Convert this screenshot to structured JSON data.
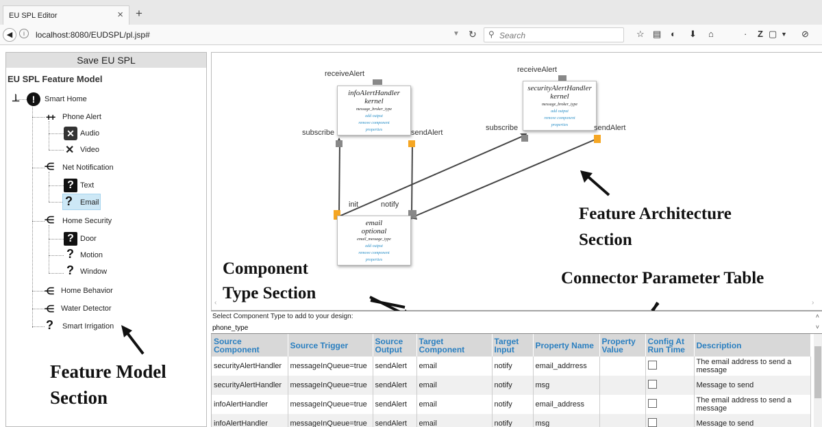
{
  "browser": {
    "tab_title": "EU SPL Editor",
    "url": "localhost:8080/EUDSPL/pl.jsp#",
    "search_placeholder": "Search"
  },
  "left_panel": {
    "save_label": "Save EU SPL",
    "title": "EU SPL Feature Model",
    "tree": {
      "root": "Smart Home",
      "phone_alert": "Phone Alert",
      "audio": "Audio",
      "video": "Video",
      "net_notification": "Net Notification",
      "text": "Text",
      "email": "Email",
      "home_security": "Home Security",
      "door": "Door",
      "motion": "Motion",
      "window": "Window",
      "home_behavior": "Home Behavior",
      "water_detector": "Water Detector",
      "smart_irrigation": "Smart Irrigation"
    }
  },
  "architecture": {
    "components": [
      {
        "name": "infoAlertHandler",
        "type": "kernel",
        "msg": "message_broker_type",
        "add": "add output",
        "remove": "remove component",
        "props": "properties",
        "in_label": "receiveAlert",
        "left_label": "subscribe",
        "right_label": "sendAlert"
      },
      {
        "name": "securityAlertHandler",
        "type": "kernel",
        "msg": "message_broker_type",
        "add": "add output",
        "remove": "remove component",
        "props": "properties",
        "in_label": "receiveAlert",
        "left_label": "subscribe",
        "right_label": "sendAlert"
      },
      {
        "name": "email",
        "type": "optional",
        "msg": "email_message_type",
        "add": "add output",
        "remove": "remove component",
        "props": "properties",
        "left_label": "init",
        "right_label": "notify"
      }
    ],
    "colors": {
      "port_out": "#f5a623",
      "port_in": "#888888",
      "link": "#2a8fc7"
    }
  },
  "annotations": {
    "feature_architecture_1": "Feature Architecture",
    "feature_architecture_2": "Section",
    "component_type_1": "Component",
    "component_type_2": "Type Section",
    "connector_table": "Connector Parameter Table",
    "feature_model_1": "Feature Model",
    "feature_model_2": "Section"
  },
  "type_select": {
    "label": "Select Component Type to add to your design:",
    "value": "phone_type"
  },
  "table": {
    "headers": [
      "Source Component",
      "Source Trigger",
      "Source Output",
      "Target Component",
      "Target Input",
      "Property Name",
      "Property Value",
      "Config At Run Time",
      "Description"
    ],
    "rows": [
      [
        "securityAlertHandler",
        "messageInQueue=true",
        "sendAlert",
        "email",
        "notify",
        "email_addrress",
        "",
        "",
        "The email address to send a message"
      ],
      [
        "securityAlertHandler",
        "messageInQueue=true",
        "sendAlert",
        "email",
        "notify",
        "msg",
        "",
        "",
        "Message to send"
      ],
      [
        "infoAlertHandler",
        "messageInQueue=true",
        "sendAlert",
        "email",
        "notify",
        "email_address",
        "",
        "",
        "The email address to send a message"
      ],
      [
        "infoAlertHandler",
        "messageInQueue=true",
        "sendAlert",
        "email",
        "notify",
        "msg",
        "",
        "",
        "Message to send"
      ]
    ]
  }
}
